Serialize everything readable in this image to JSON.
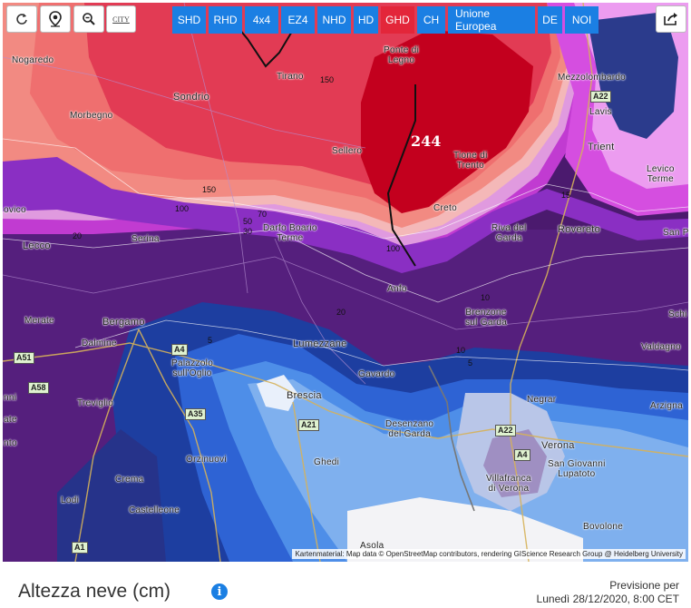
{
  "toolbar": {
    "refresh_icon": "refresh-icon",
    "locate_icon": "map-pin-icon",
    "zoom_icon": "zoom-out-icon",
    "city_label": "CITY",
    "share_icon": "share-icon"
  },
  "models": [
    {
      "label": "SHD",
      "active": false
    },
    {
      "label": "RHD",
      "active": false
    },
    {
      "label": "4x4",
      "active": false
    },
    {
      "label": "EZ4",
      "active": false
    },
    {
      "label": "NHD",
      "active": false
    },
    {
      "label": "HD",
      "active": false
    },
    {
      "label": "GHD",
      "active": true
    },
    {
      "label": "CH",
      "active": false
    },
    {
      "label": "Unione Europea",
      "active": false
    },
    {
      "label": "DE",
      "active": false
    },
    {
      "label": "NOI",
      "active": false
    }
  ],
  "places": [
    "Nogaredo",
    "Ponte di\nLegno",
    "Tirano",
    "Mezzolombardo",
    "Sondrio",
    "Lavis",
    "Morbegno",
    "Trient",
    "Sellero",
    "Tione di\nTrento",
    "Levico\nTerme",
    "Grosio",
    "Serina",
    "Darfo Boario\nTerme",
    "Creto",
    "Riva del\nGarda",
    "Rovereto",
    "San Pi",
    "Lecco",
    "Anfo",
    "Brenzone\nsul Garda",
    "Schi",
    "Merate",
    "Bergamo",
    "Dalmine",
    "Lumezzane",
    "Valdagno",
    "Palazzolo\nsull'Oglio",
    "Gavardo",
    "Brescia",
    "Negrar",
    "Arzigna",
    "Treviglio",
    "Desenzano\ndel Garda",
    "Verona",
    "San Giovanni\nLupatoto",
    "Orzinuovi",
    "Ghedi",
    "Crema",
    "Villafranca\ndi Verona",
    "Lodi",
    "Castelleone",
    "Bovolone",
    "Asola",
    "nto",
    "ate",
    "nni",
    "ovico"
  ],
  "roads": [
    "A22",
    "A4",
    "A51",
    "A58",
    "A35",
    "A21",
    "A22",
    "A4",
    "A1"
  ],
  "isolines": [
    "150",
    "150",
    "100",
    "70",
    "50",
    "30",
    "20",
    "100",
    "20",
    "10",
    "5",
    "5",
    "15",
    "10"
  ],
  "max_value": "244",
  "attribution": "Kartenmaterial: Map data © OpenStreetMap contributors, rendering GIScience Research Group @ Heidelberg University",
  "footer": {
    "title": "Altezza neve (cm)",
    "info_icon": "i",
    "forecast_label": "Previsione per",
    "forecast_time": "Lunedì 28/12/2020, 8:00 CET"
  }
}
